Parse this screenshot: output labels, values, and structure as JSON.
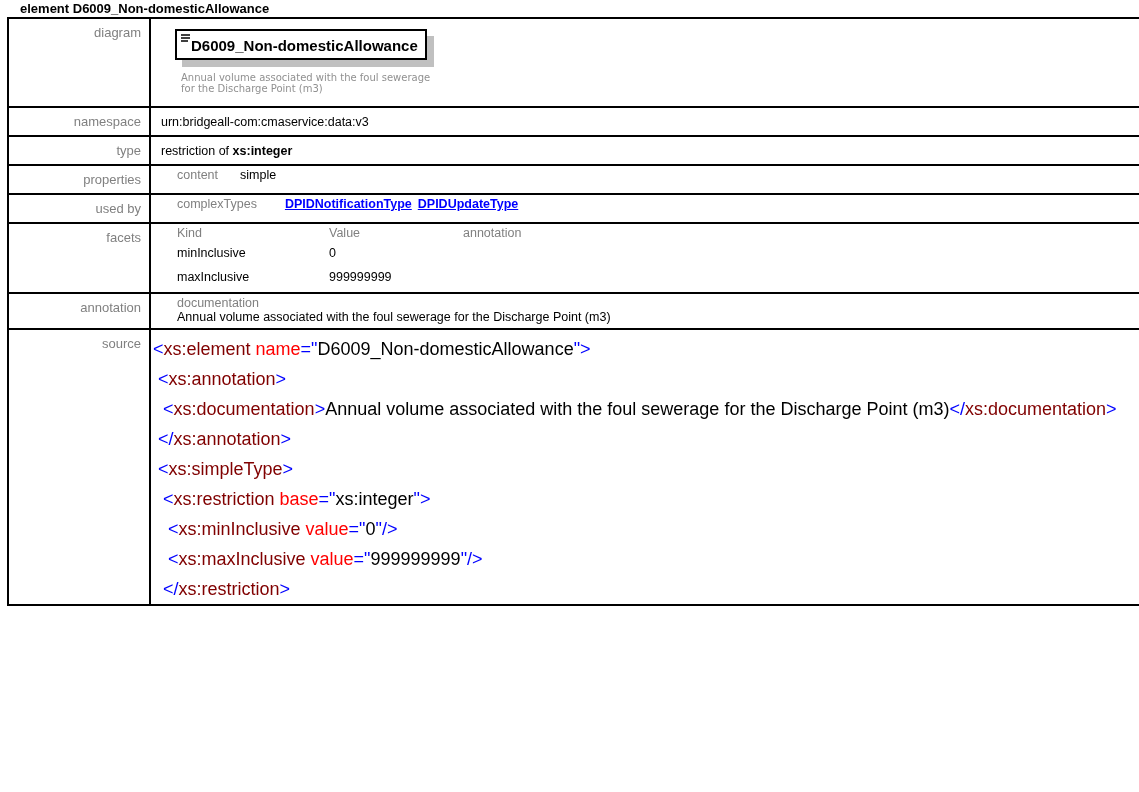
{
  "heading": "element D6009_Non-domesticAllowance",
  "diagram": {
    "label": "diagram",
    "element_name": "D6009_Non-domesticAllowance",
    "annotation": "Annual volume associated with the foul sewerage for the Discharge Point (m3)"
  },
  "namespace": {
    "label": "namespace",
    "value": "urn:bridgeall-com:cmaservice:data:v3"
  },
  "type": {
    "label": "type",
    "prefix": "restriction of",
    "base": "xs:integer"
  },
  "properties": {
    "label": "properties",
    "key": "content",
    "value": "simple"
  },
  "used_by": {
    "label": "used by",
    "key": "complexTypes",
    "links": [
      "DPIDNotificationType",
      "DPIDUpdateType"
    ]
  },
  "facets": {
    "label": "facets",
    "columns": [
      "Kind",
      "Value",
      "annotation"
    ],
    "rows": [
      {
        "kind": "minInclusive",
        "value": "0"
      },
      {
        "kind": "maxInclusive",
        "value": "999999999"
      }
    ]
  },
  "annotation": {
    "label": "annotation",
    "key": "documentation",
    "text": "Annual volume associated with the foul sewerage for the Discharge Point (m3)"
  },
  "source": {
    "label": "source",
    "lines": [
      [
        {
          "kind": "bracket",
          "text": "<"
        },
        {
          "kind": "tag",
          "text": "xs:element "
        },
        {
          "kind": "attr",
          "text": "name"
        },
        {
          "kind": "bracket",
          "text": "=\""
        },
        {
          "kind": "text",
          "text": "D6009_Non-domesticAllowance"
        },
        {
          "kind": "bracket",
          "text": "\">"
        }
      ],
      [
        {
          "kind": "bracket",
          "text": " <"
        },
        {
          "kind": "tag",
          "text": "xs:annotation"
        },
        {
          "kind": "bracket",
          "text": ">"
        }
      ],
      [
        {
          "kind": "bracket",
          "text": "  <"
        },
        {
          "kind": "tag",
          "text": "xs:documentation"
        },
        {
          "kind": "bracket",
          "text": ">"
        },
        {
          "kind": "text",
          "text": "Annual volume associated with the foul sewerage for the Discharge Point (m3)"
        },
        {
          "kind": "bracket",
          "text": "</"
        },
        {
          "kind": "tag",
          "text": "xs:documentation"
        },
        {
          "kind": "bracket",
          "text": ">"
        }
      ],
      [
        {
          "kind": "bracket",
          "text": " </"
        },
        {
          "kind": "tag",
          "text": "xs:annotation"
        },
        {
          "kind": "bracket",
          "text": ">"
        }
      ],
      [
        {
          "kind": "bracket",
          "text": " <"
        },
        {
          "kind": "tag",
          "text": "xs:simpleType"
        },
        {
          "kind": "bracket",
          "text": ">"
        }
      ],
      [
        {
          "kind": "bracket",
          "text": "  <"
        },
        {
          "kind": "tag",
          "text": "xs:restriction "
        },
        {
          "kind": "attr",
          "text": "base"
        },
        {
          "kind": "bracket",
          "text": "=\""
        },
        {
          "kind": "text",
          "text": "xs:integer"
        },
        {
          "kind": "bracket",
          "text": "\">"
        }
      ],
      [
        {
          "kind": "bracket",
          "text": "   <"
        },
        {
          "kind": "tag",
          "text": "xs:minInclusive "
        },
        {
          "kind": "attr",
          "text": "value"
        },
        {
          "kind": "bracket",
          "text": "=\""
        },
        {
          "kind": "text",
          "text": "0"
        },
        {
          "kind": "bracket",
          "text": "\"/>"
        }
      ],
      [
        {
          "kind": "bracket",
          "text": "   <"
        },
        {
          "kind": "tag",
          "text": "xs:maxInclusive "
        },
        {
          "kind": "attr",
          "text": "value"
        },
        {
          "kind": "bracket",
          "text": "=\""
        },
        {
          "kind": "text",
          "text": "999999999"
        },
        {
          "kind": "bracket",
          "text": "\"/>"
        }
      ],
      [
        {
          "kind": "bracket",
          "text": "  </"
        },
        {
          "kind": "tag",
          "text": "xs:restriction"
        },
        {
          "kind": "bracket",
          "text": ">"
        }
      ]
    ]
  }
}
